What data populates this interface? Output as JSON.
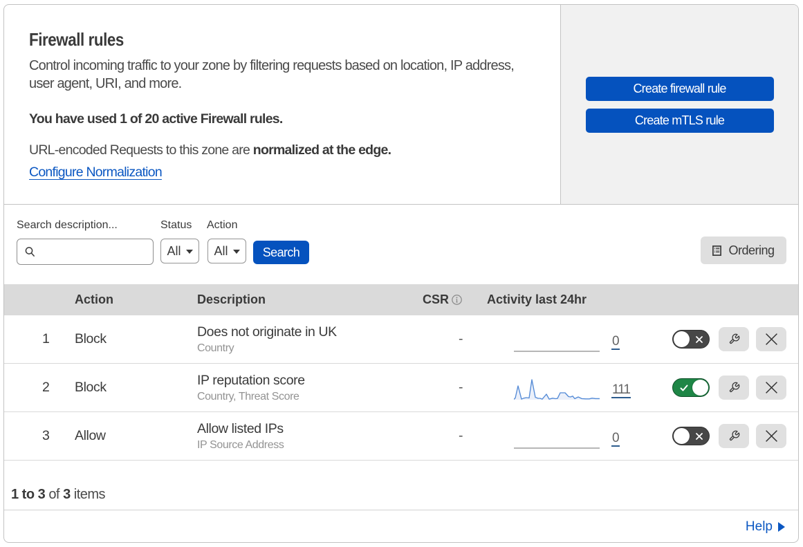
{
  "colors": {
    "primary_blue": "#0552be",
    "toggle_on_green": "#1e8646",
    "toggle_off_gray": "#474747",
    "sparkline_blue": "#5488d8",
    "activity_underline": "#2e5f94",
    "panel_gray": "#f1f1f1",
    "table_header_gray": "#dadada"
  },
  "header": {
    "title": "Firewall rules",
    "description_lines": [
      "Control incoming traffic to your zone by filtering requests based on location, IP address,",
      "user agent, URI, and more."
    ],
    "usage_text": "You have used 1 of 20 active Firewall rules.",
    "normalization_prefix": "URL-encoded Requests to this zone are ",
    "normalization_bold": "normalized at the edge.",
    "normalization_link": "Configure Normalization",
    "create_firewall_label": "Create firewall rule",
    "create_mtls_label": "Create mTLS rule"
  },
  "filters": {
    "search_label": "Search description...",
    "search_value": "",
    "status_label": "Status",
    "status_value": "All",
    "action_label": "Action",
    "action_value": "All",
    "search_button_label": "Search",
    "ordering_button_label": "Ordering"
  },
  "table": {
    "columns": {
      "action": "Action",
      "description": "Description",
      "csr": "CSR",
      "activity": "Activity last 24hr"
    },
    "rows": [
      {
        "index": "1",
        "action": "Block",
        "description": "Does not originate in UK",
        "criteria": "Country",
        "csr": "-",
        "activity": "0",
        "enabled": false,
        "sparkline": []
      },
      {
        "index": "2",
        "action": "Block",
        "description": "IP reputation score",
        "criteria": "Country, Threat Score",
        "csr": "-",
        "activity": "111",
        "enabled": true,
        "sparkline": [
          [
            0,
            0.5
          ],
          [
            2,
            2.5
          ],
          [
            6,
            20
          ],
          [
            11,
            0.8
          ],
          [
            14,
            2.2
          ],
          [
            18,
            3
          ],
          [
            22,
            2.5
          ],
          [
            26,
            29
          ],
          [
            31,
            3.5
          ],
          [
            35,
            2
          ],
          [
            38,
            2
          ],
          [
            41,
            0.8
          ],
          [
            47,
            8
          ],
          [
            51,
            0.8
          ],
          [
            56,
            2.2
          ],
          [
            60,
            1.5
          ],
          [
            63,
            1.8
          ],
          [
            67,
            10
          ],
          [
            74,
            10
          ],
          [
            79,
            4.5
          ],
          [
            82,
            4
          ],
          [
            85,
            5.2
          ],
          [
            88,
            1.5
          ],
          [
            93,
            4
          ],
          [
            98,
            1.6
          ],
          [
            104,
            1.2
          ],
          [
            109,
            1.2
          ],
          [
            113,
            2.2
          ],
          [
            118,
            1.6
          ],
          [
            124,
            1.6
          ]
        ]
      },
      {
        "index": "3",
        "action": "Allow",
        "description": "Allow listed IPs",
        "criteria": "IP Source Address",
        "csr": "-",
        "activity": "0",
        "enabled": false,
        "sparkline": []
      }
    ]
  },
  "pagination": {
    "range": "1 to 3",
    "of": "of",
    "total": "3",
    "items": "items"
  },
  "footer": {
    "help_label": "Help"
  }
}
